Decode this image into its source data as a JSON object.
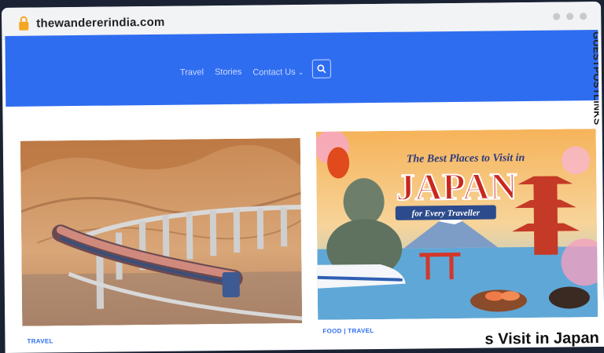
{
  "browser": {
    "url": "thewandererindia.com"
  },
  "nav": {
    "links": [
      {
        "label": "Travel"
      },
      {
        "label": "Stories"
      },
      {
        "label": "Contact Us"
      }
    ],
    "contact_caret": "⌄"
  },
  "posts": [
    {
      "category": "TRAVEL",
      "image": "desert-train-viaduct"
    },
    {
      "category": "FOOD | TRAVEL",
      "image": "japan-poster",
      "poster_text": {
        "line1": "The Best Places to Visit in",
        "line2": "JAPAN",
        "line3": "for Every Traveller"
      },
      "title_partial": "s Visit in Japan"
    }
  ],
  "watermark": {
    "text": "GUESTPOSTLINKS"
  },
  "colors": {
    "nav_bg": "#2f6df0",
    "accent": "#2f6df0"
  }
}
